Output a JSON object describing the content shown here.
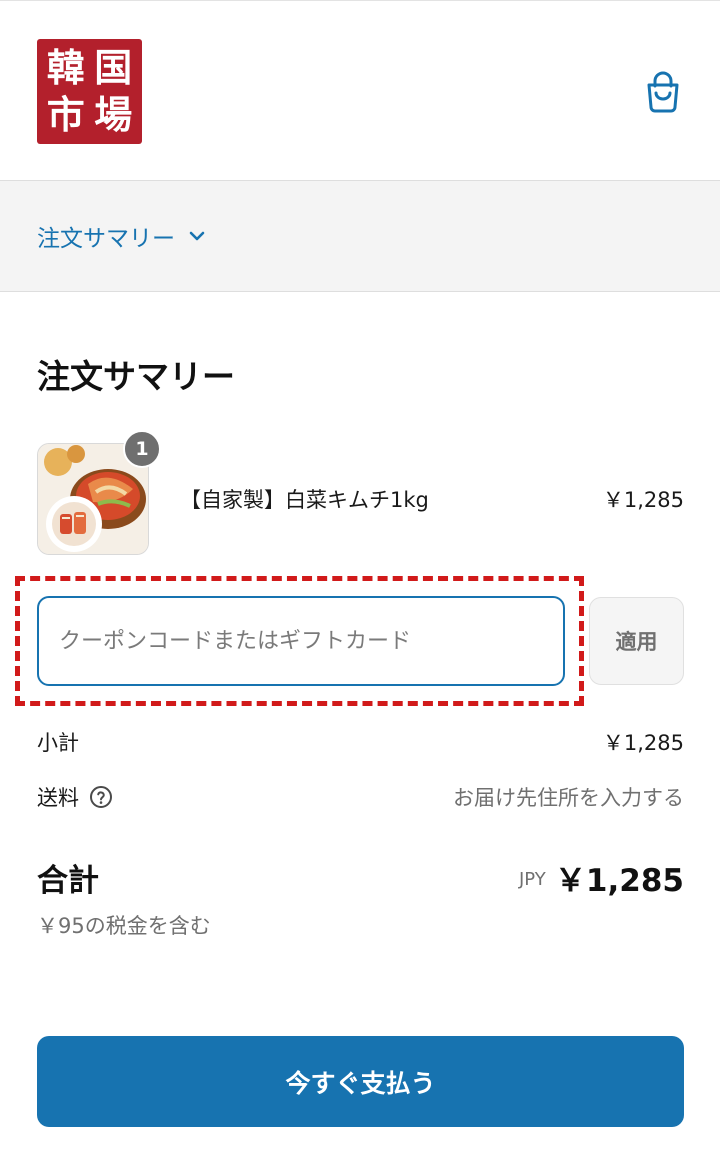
{
  "header": {
    "logo_chars": [
      "韓",
      "国",
      "市",
      "場"
    ],
    "cart_icon": "shopping-bag-icon"
  },
  "summary_toggle": {
    "label": "注文サマリー",
    "icon": "chevron-down-icon"
  },
  "order_summary": {
    "title": "注文サマリー",
    "items": [
      {
        "name": "【自家製】白菜キムチ1kg",
        "price": "￥1,285",
        "quantity": "1"
      }
    ]
  },
  "coupon": {
    "placeholder": "クーポンコードまたはギフトカード",
    "value": "",
    "apply_label": "適用"
  },
  "totals": {
    "subtotal_label": "小計",
    "subtotal_value": "￥1,285",
    "shipping_label": "送料",
    "shipping_value": "お届け先住所を入力する",
    "total_label": "合計",
    "currency": "JPY",
    "total_value": "￥1,285",
    "tax_note": "￥95の税金を含む"
  },
  "pay_button": {
    "label": "今すぐ支払う"
  },
  "colors": {
    "accent": "#1773b0",
    "logo_red": "#b3202c",
    "highlight_dashed": "#d11a1a"
  }
}
